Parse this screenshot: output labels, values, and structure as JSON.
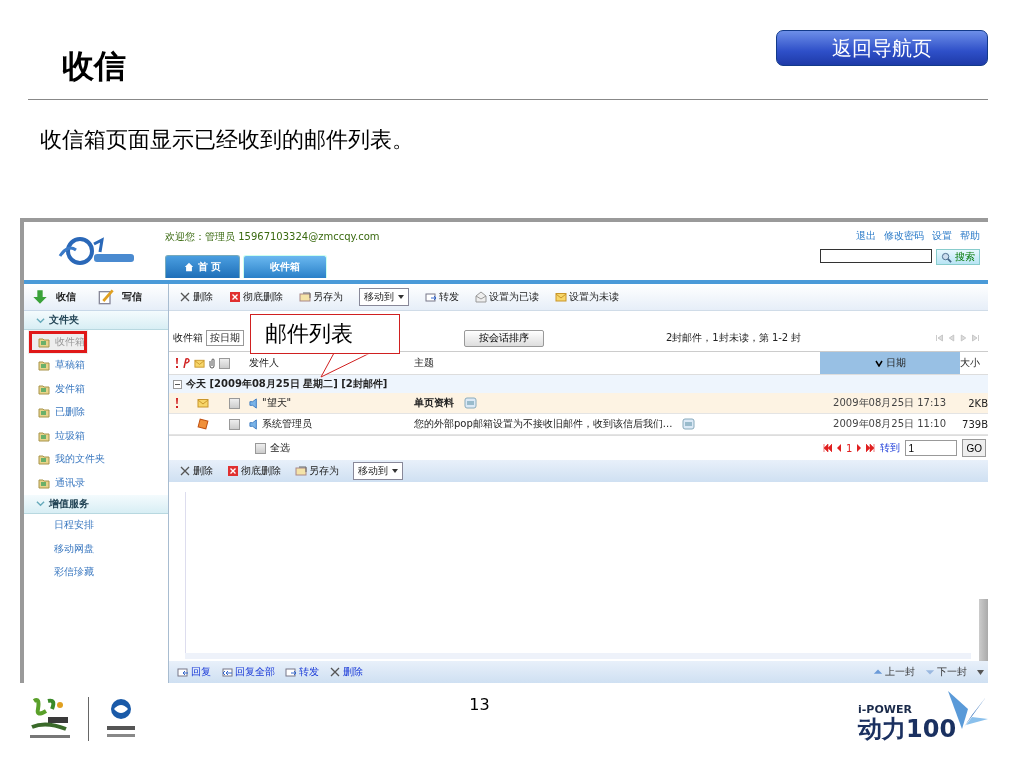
{
  "slide": {
    "title": "收信",
    "nav_button": "返回导航页",
    "subtitle": "收信箱页面显示已经收到的邮件列表。",
    "page_number": "13",
    "footer_logo": {
      "tagline": "i-POWER",
      "name": "动力100"
    }
  },
  "app": {
    "welcome": "欢迎您：管理员  15967103324@zmccqy.com",
    "tabs": [
      {
        "label": "首 页",
        "selected": false,
        "kind": "home"
      },
      {
        "label": "收件箱",
        "selected": true,
        "kind": "plain"
      }
    ],
    "top_links": [
      "退出",
      "修改密码",
      "设置",
      "帮助"
    ],
    "search": {
      "button": "搜索"
    },
    "sidebar": {
      "actions": [
        {
          "label": "收信",
          "kind": "receive"
        },
        {
          "label": "写信",
          "kind": "compose"
        }
      ],
      "sections": [
        {
          "label": "文件夹",
          "expanded": true,
          "items": [
            {
              "label": "收件箱",
              "selected": true,
              "kind": "folder"
            },
            {
              "label": "草稿箱",
              "selected": false,
              "kind": "folder"
            },
            {
              "label": "发件箱",
              "selected": false,
              "kind": "folder"
            },
            {
              "label": "已删除",
              "selected": false,
              "kind": "folder"
            },
            {
              "label": "垃圾箱",
              "selected": false,
              "kind": "folder"
            },
            {
              "label": "我的文件夹",
              "selected": false,
              "kind": "folder"
            },
            {
              "label": "通讯录",
              "selected": false,
              "kind": "folder"
            }
          ]
        },
        {
          "label": "增值服务",
          "expanded": true,
          "items": [
            {
              "label": "日程安排",
              "selected": false,
              "kind": "link"
            },
            {
              "label": "移动网盘",
              "selected": false,
              "kind": "link"
            },
            {
              "label": "彩信珍藏",
              "selected": false,
              "kind": "link"
            }
          ]
        }
      ]
    },
    "toolbar": [
      {
        "label": "删除",
        "kind": "delete"
      },
      {
        "label": "彻底删除",
        "kind": "purge"
      },
      {
        "label": "另存为",
        "kind": "save"
      },
      {
        "label": "移动到",
        "kind": "dropdown"
      },
      {
        "label": "转发",
        "kind": "forward"
      },
      {
        "label": "设置为已读",
        "kind": "read"
      },
      {
        "label": "设置为未读",
        "kind": "unread"
      }
    ],
    "filter": {
      "folder_label": "收件箱",
      "sort_select": "按日期",
      "sort_button": "按会话排序",
      "summary": "2封邮件，1封未读，第 1-2 封"
    },
    "columns": {
      "checked": false,
      "sender": "发件人",
      "subject": "主题",
      "date": "日期",
      "size": "大小"
    },
    "group": {
      "label": "今天 [2009年08月25日 星期二] [2封邮件]",
      "expanded": true
    },
    "rows": [
      {
        "important": true,
        "unread": true,
        "checked": false,
        "sender": "\"望天\"",
        "subject": "单页资料",
        "date": "2009年08月25日 17:13",
        "size": "2KB"
      },
      {
        "important": false,
        "unread": false,
        "checked": false,
        "sender": "系统管理员",
        "subject": "您的外部pop邮箱设置为不接收旧邮件，收到该信后我们...",
        "date": "2009年08月25日 11:10",
        "size": "739B"
      }
    ],
    "select_all": "全选",
    "select_all_checked": false,
    "pager": {
      "page": "1",
      "goto_label": "转到",
      "goto_value": "1",
      "go_button": "GO"
    },
    "bottom_toolbar": [
      {
        "label": "删除",
        "kind": "delete"
      },
      {
        "label": "彻底删除",
        "kind": "purge"
      },
      {
        "label": "另存为",
        "kind": "save"
      },
      {
        "label": "移动到",
        "kind": "dropdown"
      }
    ],
    "reader_actions": [
      {
        "label": "回复",
        "kind": "reply"
      },
      {
        "label": "回复全部",
        "kind": "reply_all"
      },
      {
        "label": "转发",
        "kind": "forward"
      },
      {
        "label": "删除",
        "kind": "delete"
      }
    ],
    "nav_links": [
      {
        "label": "上一封",
        "kind": "prev"
      },
      {
        "label": "下一封",
        "kind": "next"
      }
    ]
  },
  "callout": {
    "text": "邮件列表"
  }
}
